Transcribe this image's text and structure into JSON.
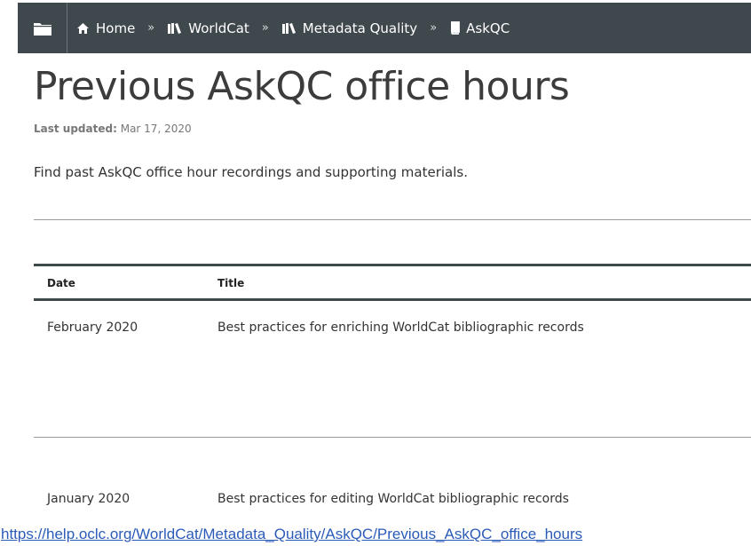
{
  "breadcrumb": {
    "items": [
      {
        "label": "Home",
        "icon": "home-icon"
      },
      {
        "label": "WorldCat",
        "icon": "books-icon"
      },
      {
        "label": "Metadata Quality",
        "icon": "books-icon"
      },
      {
        "label": "AskQC",
        "icon": "book-icon"
      }
    ],
    "separator": "»"
  },
  "page": {
    "title": "Previous AskQC office hours",
    "updated_label": "Last updated:",
    "updated_value": "Mar 17, 2020",
    "intro": "Find past AskQC office hour recordings and supporting materials."
  },
  "table": {
    "headers": [
      "Date",
      "Title"
    ],
    "rows": [
      {
        "date": "February 2020",
        "title": "Best practices for enriching WorldCat bibliographic records"
      },
      {
        "date": "January 2020",
        "title": "Best practices for editing WorldCat bibliographic records"
      }
    ]
  },
  "footer": {
    "url": "https://help.oclc.org/WorldCat/Metadata_Quality/AskQC/Previous_AskQC_office_hours"
  },
  "colors": {
    "topbar": "#3f484d",
    "link": "#2b5bb8"
  }
}
